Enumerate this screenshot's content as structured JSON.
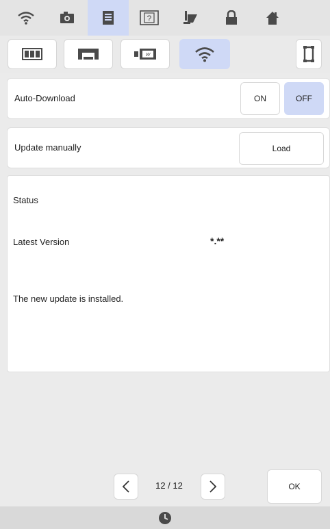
{
  "topbar": {
    "icons": [
      "wifi-icon",
      "camera-icon",
      "document-icon",
      "help-icon",
      "presser-foot-icon",
      "lock-icon",
      "home-icon"
    ],
    "active_index": 2
  },
  "subtabs": {
    "icons": [
      "book-icon",
      "machine-icon",
      "embroidery-unit-icon",
      "wifi-icon",
      "frame-icon"
    ],
    "active_index": 3
  },
  "auto_download": {
    "label": "Auto-Download",
    "on_label": "ON",
    "off_label": "OFF",
    "selected": "OFF"
  },
  "update_manually": {
    "label": "Update manually",
    "load_label": "Load"
  },
  "status": {
    "heading": "Status",
    "latest_version_label": "Latest Version",
    "latest_version_value": "*.**",
    "message": "The new update is installed."
  },
  "pager": {
    "text": "12 / 12"
  },
  "footer": {
    "ok_label": "OK"
  },
  "colors": {
    "accent": "#cfd9f6",
    "background": "#ebebeb",
    "panel": "#ffffff"
  }
}
